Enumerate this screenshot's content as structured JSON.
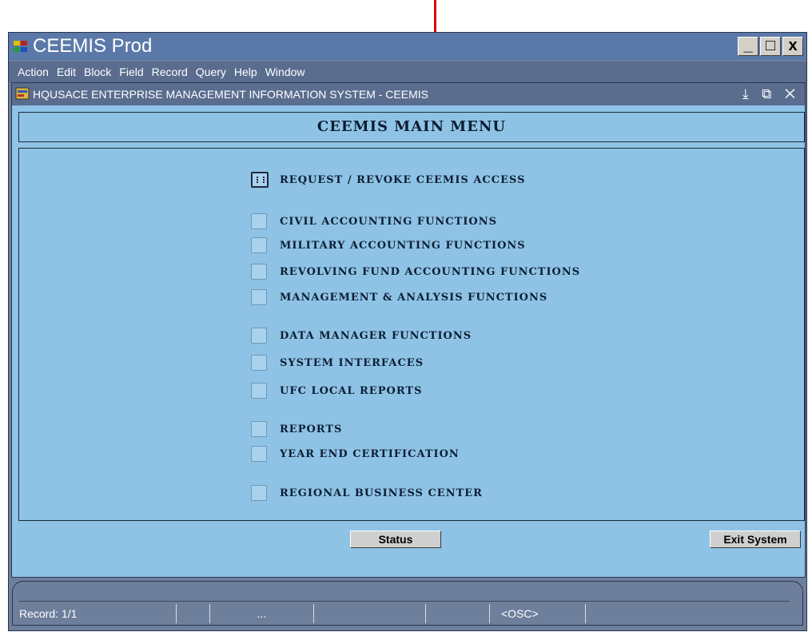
{
  "app": {
    "title": "CEEMIS Prod",
    "window_buttons": [
      "_",
      "□",
      "x"
    ]
  },
  "menubar": [
    "Action",
    "Edit",
    "Block",
    "Field",
    "Record",
    "Query",
    "Help",
    "Window"
  ],
  "inner_window": {
    "title": "HQUSACE ENTERPRISE MANAGEMENT INFORMATION SYSTEM - CEEMIS",
    "controls": "⤓ ⧉ ✕"
  },
  "main": {
    "header": "CEEMIS MAIN MENU",
    "options": [
      {
        "label": "REQUEST / REVOKE CEEMIS ACCESS",
        "active": true
      },
      {
        "label": "CIVIL ACCOUNTING FUNCTIONS"
      },
      {
        "label": "MILITARY ACCOUNTING FUNCTIONS"
      },
      {
        "label": "REVOLVING FUND ACCOUNTING FUNCTIONS"
      },
      {
        "label": "MANAGEMENT & ANALYSIS FUNCTIONS"
      },
      {
        "label": "DATA MANAGER FUNCTIONS"
      },
      {
        "label": "SYSTEM INTERFACES"
      },
      {
        "label": "UFC LOCAL REPORTS"
      },
      {
        "label": "REPORTS"
      },
      {
        "label": "YEAR END CERTIFICATION"
      },
      {
        "label": "REGIONAL BUSINESS CENTER"
      }
    ],
    "status_button": "Status",
    "exit_button": "Exit System"
  },
  "statusbar": {
    "record": "Record: 1/1",
    "ellipsis": "...",
    "mode": "<OSC>"
  }
}
